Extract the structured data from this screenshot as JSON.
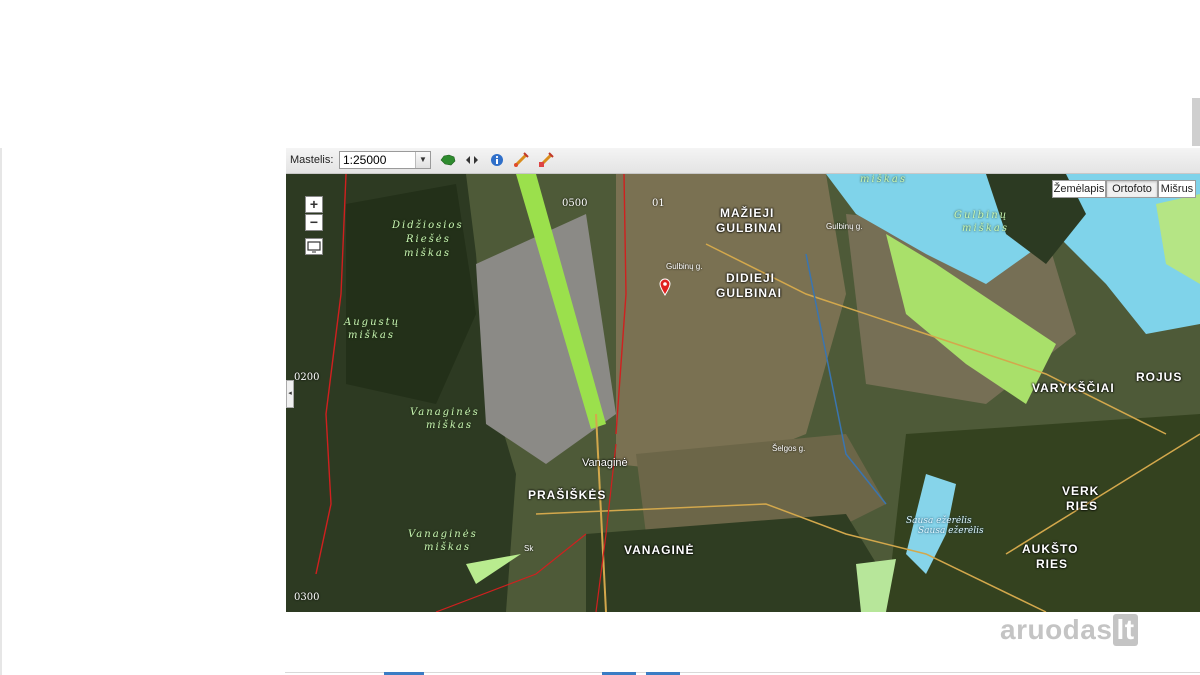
{
  "toolbar": {
    "scale_label": "Mastelis:",
    "scale_value": "1:25000",
    "tools": [
      "lithuania-map-icon",
      "pan-arrows-icon",
      "info-icon",
      "measure-line-icon",
      "measure-area-icon"
    ]
  },
  "basemaps": {
    "map": "Žemėlapis",
    "ortho": "Ortofoto",
    "mixed": "Mišrus",
    "selected": "Ortofoto"
  },
  "zoom": {
    "in": "+",
    "out": "−"
  },
  "map": {
    "places": {
      "maziej": "MAŽIEJI",
      "gulbinai1": "GULBINAI",
      "didieji": "DIDIEJI",
      "gulbinai2": "GULBINAI",
      "varyksciai": "VARYKŠČIAI",
      "rojus": "ROJUS",
      "vanagine_village": "Vanaginė",
      "prasiskes": "PRAŠIŠKĖS",
      "vanagine": "VANAGINĖ",
      "verk": "VERK",
      "ries1": "RIES",
      "aukstoji": "AUKŠTO",
      "ries2": "RIES"
    },
    "forests": {
      "didzioji_1": "Didžiosios",
      "didzioji_2": "Riešės",
      "didzioji_3": "miškas",
      "augustu_1": "Augustų",
      "augustu_2": "miškas",
      "vanagines_1": "Vanaginės",
      "vanagines_2": "miškas",
      "vanagines2_1": "Vanaginės",
      "vanagines2_2": "miškas",
      "gulbinu_1": "Gulbinų",
      "gulbinu_2": "miškas",
      "top": "miškas"
    },
    "waters": {
      "sausa_1": "Sausa ežerėlis",
      "sausa_2": "Sausa ežerėlis"
    },
    "roads": {
      "gulbinu_g": "Gulbinų g.",
      "gulbinu_g2": "Gulbinų g.",
      "selgos_g": "Šelgos g.",
      "sk": "Sk"
    },
    "grid": {
      "g0200": "0200",
      "g0300": "0300",
      "g0500": "0500",
      "g0x": "01"
    },
    "marker": "red-location-pin-icon"
  },
  "watermark": {
    "name": "aruodas",
    "tld": "lt"
  }
}
